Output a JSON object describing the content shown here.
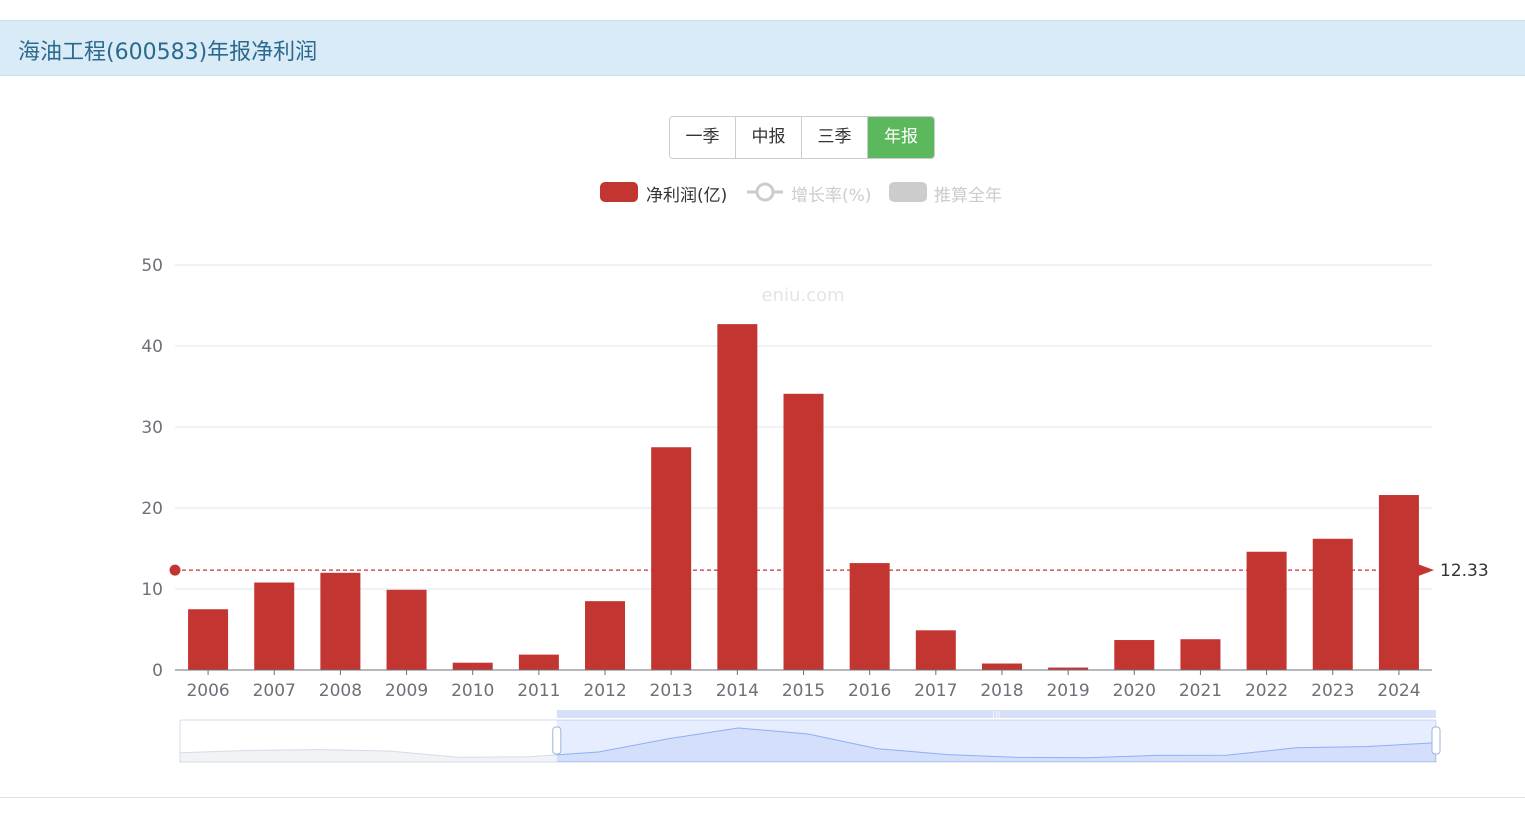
{
  "header": {
    "title": "海油工程(600583)年报净利润"
  },
  "period_buttons": [
    {
      "label": "一季",
      "active": false
    },
    {
      "label": "中报",
      "active": false
    },
    {
      "label": "三季",
      "active": false
    },
    {
      "label": "年报",
      "active": true
    }
  ],
  "legend": [
    {
      "name": "净利润(亿)",
      "color": "#c23531",
      "enabled": true,
      "marker": "bar"
    },
    {
      "name": "增长率(%)",
      "color": "#cccccc",
      "enabled": false,
      "marker": "line"
    },
    {
      "name": "推算全年",
      "color": "#cccccc",
      "enabled": false,
      "marker": "bar"
    }
  ],
  "watermark": "eniu.com",
  "colors": {
    "bar": "#c23531",
    "grid": "#e0e6f1",
    "axis": "#6e7079",
    "zoom_fill": "#d4e0fb",
    "zoom_line": "#8fb0f7"
  },
  "chart_data": {
    "type": "bar",
    "categories": [
      "2006",
      "2007",
      "2008",
      "2009",
      "2010",
      "2011",
      "2012",
      "2013",
      "2014",
      "2015",
      "2016",
      "2017",
      "2018",
      "2019",
      "2020",
      "2021",
      "2022",
      "2023",
      "2024"
    ],
    "series": [
      {
        "name": "净利润(亿)",
        "values": [
          7.5,
          10.8,
          12.0,
          9.9,
          0.9,
          1.9,
          8.5,
          27.5,
          42.7,
          34.1,
          13.2,
          4.9,
          0.8,
          0.3,
          3.7,
          3.8,
          14.6,
          16.2,
          21.6
        ]
      }
    ],
    "yticks": [
      0,
      10,
      20,
      30,
      40,
      50
    ],
    "ylim": [
      0,
      50
    ],
    "average_line": {
      "value": 12.33,
      "label": "12.33"
    },
    "grid": true,
    "legend_position": "top-center",
    "data_zoom": {
      "start_fraction": 0.3,
      "end_fraction": 1.0
    }
  }
}
